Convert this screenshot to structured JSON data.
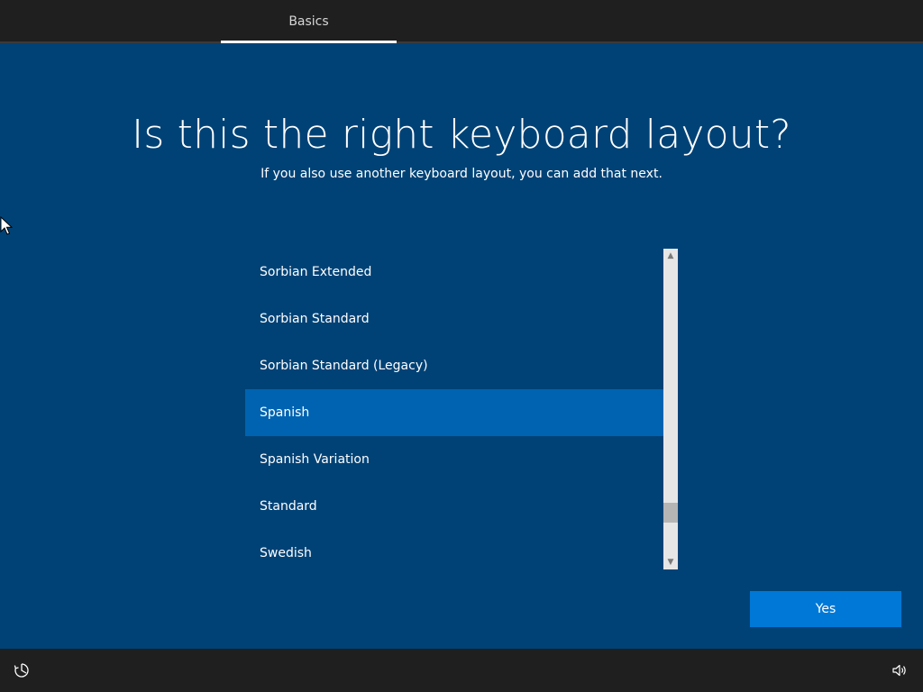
{
  "header": {
    "step_label": "Basics"
  },
  "main": {
    "title": "Is this the right keyboard layout?",
    "subtitle": "If you also use another keyboard layout, you can add that next."
  },
  "layout_list": {
    "items": [
      {
        "label": "Sorbian Extended"
      },
      {
        "label": "Sorbian Standard"
      },
      {
        "label": "Sorbian Standard (Legacy)"
      },
      {
        "label": "Spanish",
        "selected": true
      },
      {
        "label": "Spanish Variation"
      },
      {
        "label": "Standard"
      },
      {
        "label": "Swedish"
      }
    ],
    "selected_label": "Spanish"
  },
  "actions": {
    "yes_label": "Yes"
  },
  "footer": {
    "left_icon": "ease-of-access-icon",
    "right_icon": "volume-icon"
  },
  "colors": {
    "background": "#004276",
    "selected_item": "#0063b1",
    "primary_button": "#0078d7",
    "bars": "#1f1f1f"
  }
}
